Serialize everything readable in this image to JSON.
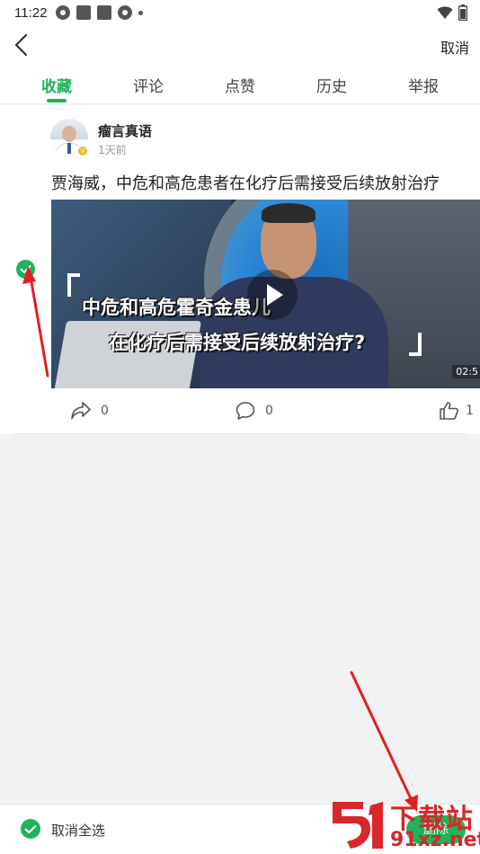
{
  "status_bar": {
    "time": "11:22",
    "left_icons": [
      "aperture-icon",
      "square-icon",
      "square-icon",
      "aperture-icon",
      "dot-icon"
    ],
    "right_icons": [
      "wifi-icon",
      "battery-icon"
    ]
  },
  "top_bar": {
    "back_icon": "chevron-left-icon",
    "cancel_label": "取消"
  },
  "tabs": [
    {
      "label": "收藏",
      "active": true
    },
    {
      "label": "评论",
      "active": false
    },
    {
      "label": "点赞",
      "active": false
    },
    {
      "label": "历史",
      "active": false
    },
    {
      "label": "举报",
      "active": false
    }
  ],
  "post": {
    "selected": true,
    "author": "瘤言真语",
    "verified_badge": "V",
    "time": "1天前",
    "title": "贾海威，中危和高危患者在化疗后需接受后续放射治疗",
    "video": {
      "caption_line1": "中危和高危霍奇金患儿",
      "caption_line2": "在化疗后需接受后续放射治疗?",
      "duration": "02:5"
    },
    "actions": {
      "share_count": "0",
      "comment_count": "0",
      "like_count": "1"
    }
  },
  "bottom_bar": {
    "deselect_label": "取消全选",
    "delete_label": "删除"
  },
  "watermark": {
    "title": "下载站",
    "url": "91xz.net"
  },
  "colors": {
    "accent": "#1fb35a",
    "annotation_arrow": "#e02020",
    "background": "#f2f2f2"
  }
}
